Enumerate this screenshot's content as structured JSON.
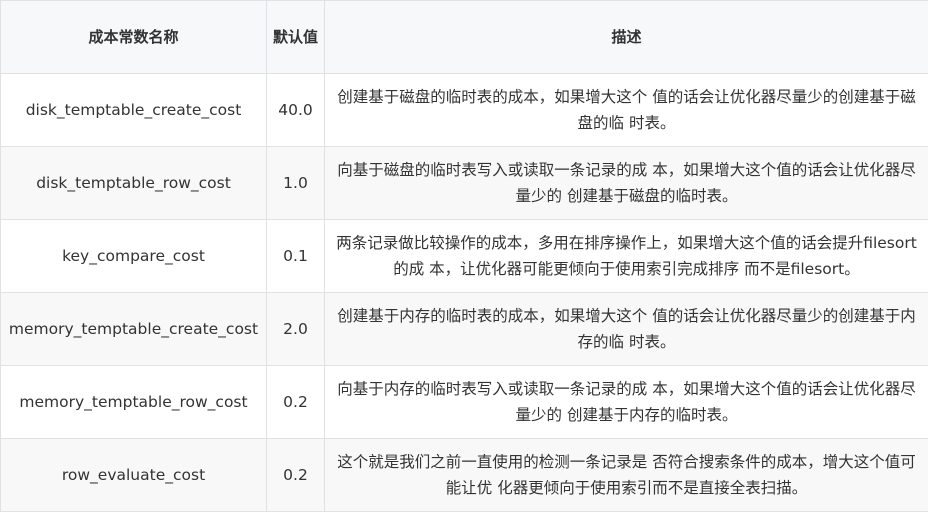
{
  "table": {
    "headers": {
      "name": "成本常数名称",
      "default_value": "默认值",
      "description": "描述"
    },
    "rows": [
      {
        "name": "disk_temptable_create_cost",
        "value": "40.0",
        "description": "创建基于磁盘的临时表的成本，如果增大这个 值的话会让优化器尽量少的创建基于磁盘的临 时表。"
      },
      {
        "name": "disk_temptable_row_cost",
        "value": "1.0",
        "description": "向基于磁盘的临时表写入或读取一条记录的成 本，如果增大这个值的话会让优化器尽量少的 创建基于磁盘的临时表。"
      },
      {
        "name": "key_compare_cost",
        "value": "0.1",
        "description": "两条记录做比较操作的成本，多用在排序操作上，如果增大这个值的话会提升filesort的成 本，让优化器可能更倾向于使用索引完成排序 而不是filesort。"
      },
      {
        "name": "memory_temptable_create_cost",
        "value": "2.0",
        "description": "创建基于内存的临时表的成本，如果增大这个 值的话会让优化器尽量少的创建基于内存的临 时表。"
      },
      {
        "name": "memory_temptable_row_cost",
        "value": "0.2",
        "description": "向基于内存的临时表写入或读取一条记录的成 本，如果增大这个值的话会让优化器尽量少的 创建基于内存的临时表。"
      },
      {
        "name": "row_evaluate_cost",
        "value": "0.2",
        "description": "这个就是我们之前一直使用的检测一条记录是 否符合搜索条件的成本，增大这个值可能让优 化器更倾向于使用索引而不是直接全表扫描。"
      }
    ]
  }
}
